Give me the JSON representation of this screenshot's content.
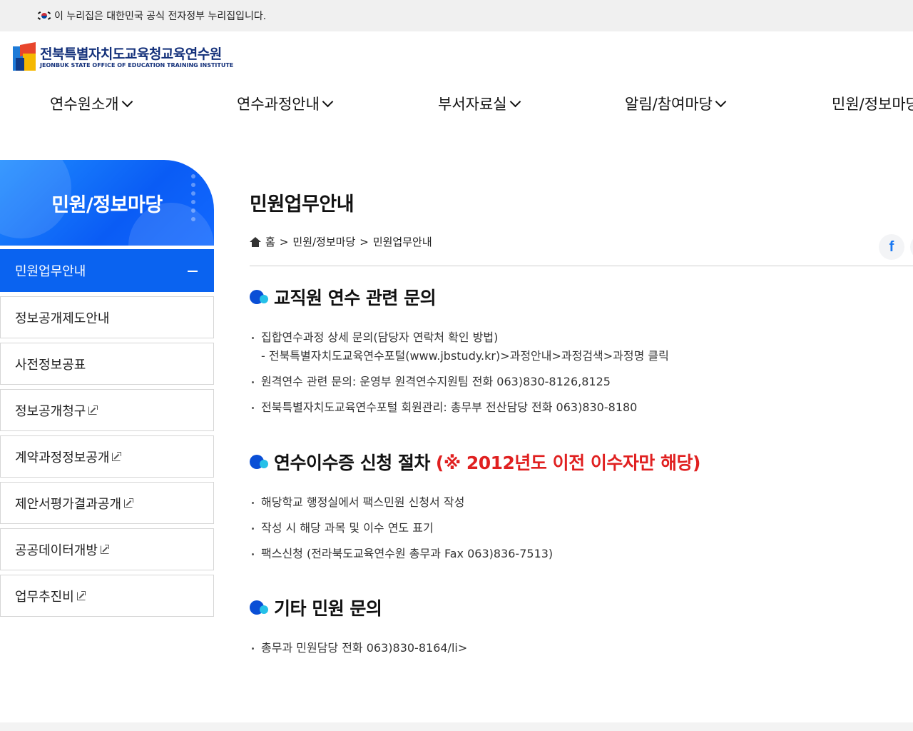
{
  "gov_banner": {
    "text": "이 누리집은 대한민국 공식 전자정부 누리집입니다."
  },
  "logo": {
    "ko": "전북특별자치도교육청교육연수원",
    "en": "JEONBUK STATE OFFICE OF EDUCATION TRAINING INSTITUTE"
  },
  "gnb": {
    "items": [
      {
        "label": "연수원소개"
      },
      {
        "label": "연수과정안내"
      },
      {
        "label": "부서자료실"
      },
      {
        "label": "알림/참여마당"
      },
      {
        "label": "민원/정보마당"
      }
    ]
  },
  "lnb": {
    "title": "민원/정보마당",
    "items": [
      {
        "label": "민원업무안내",
        "active": true
      },
      {
        "label": "정보공개제도안내"
      },
      {
        "label": "사전정보공표"
      },
      {
        "label": "정보공개청구",
        "external": true
      },
      {
        "label": "계약과정정보공개",
        "external": true
      },
      {
        "label": "제안서평가결과공개",
        "external": true
      },
      {
        "label": "공공데이터개방",
        "external": true
      },
      {
        "label": "업무추진비",
        "external": true
      }
    ]
  },
  "content": {
    "title": "민원업무안내",
    "breadcrumb": {
      "home": "홈",
      "sep": ">",
      "level1": "민원/정보마당",
      "level2": "민원업무안내"
    },
    "share_facebook": "f",
    "sections": [
      {
        "heading": "교직원 연수 관련 문의",
        "items": [
          {
            "text": "집합연수과정 상세 문의(담당자 연락처 확인 방법)",
            "sub": "- 전북특별자치도교육연수포털(www.jbstudy.kr)>과정안내>과정검색>과정명 클릭"
          },
          {
            "text": "원격연수 관련 문의: 운영부 원격연수지원팀 전화 063)830-8126,8125"
          },
          {
            "text": "전북특별자치도교육연수포털 회원관리: 총무부 전산담당 전화 063)830-8180"
          }
        ]
      },
      {
        "heading": "연수이수증 신청 절차",
        "heading_note": "(※ 2012년도 이전 이수자만 해당)",
        "items": [
          {
            "text": "해당학교 행정실에서 팩스민원 신청서 작성"
          },
          {
            "text": "작성 시 해당 과목 및 이수 연도 표기"
          },
          {
            "text": "팩스신청 (전라북도교육연수원 총무과 Fax 063)836-7513)"
          }
        ]
      },
      {
        "heading": "기타 민원 문의",
        "items": [
          {
            "text": "총무과 민원담당 전화 063)830-8164/li>"
          }
        ]
      }
    ]
  },
  "colors": {
    "accent": "#0a63f0",
    "highlight_red": "#e02020",
    "logo_navy": "#13307a"
  }
}
